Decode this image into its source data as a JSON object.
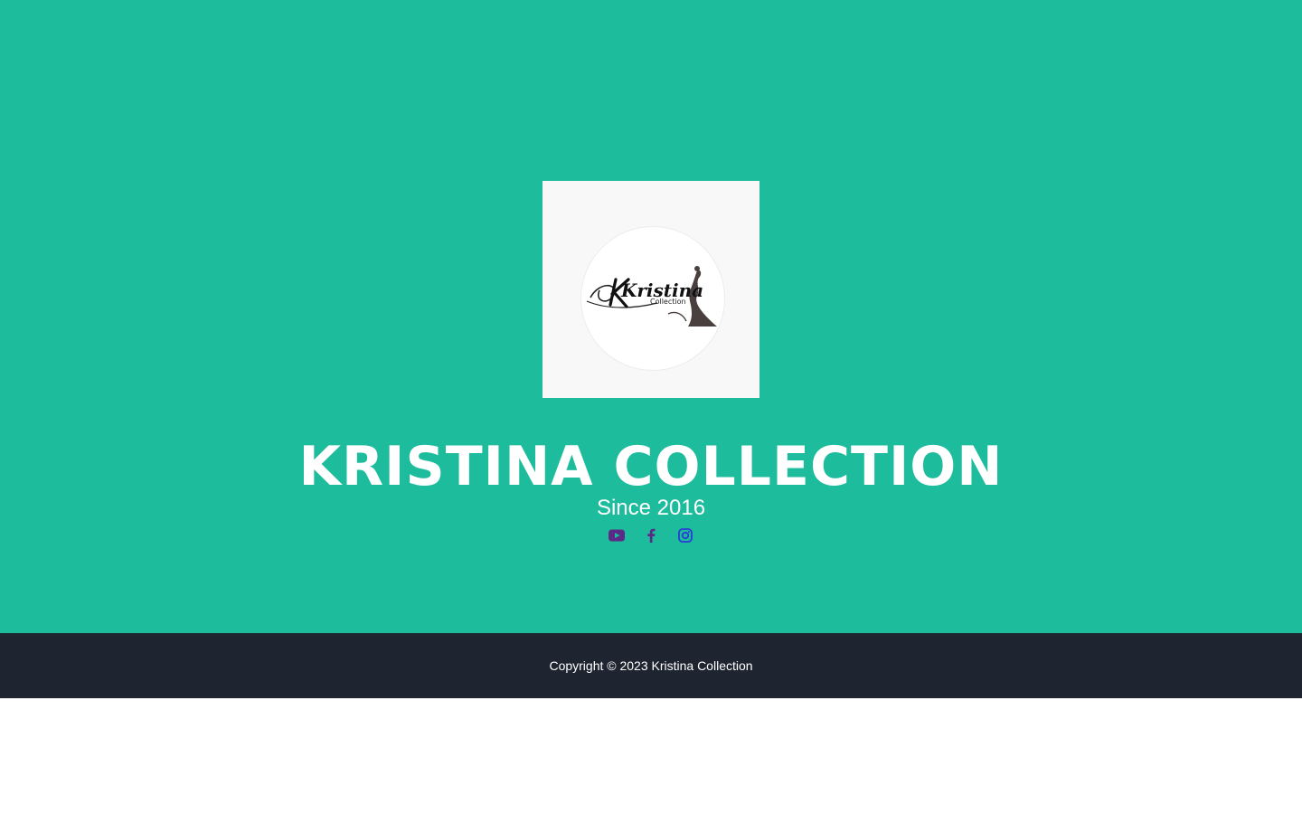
{
  "hero": {
    "background_color": "#1dbc9c",
    "logo": {
      "brand_text": "Kristina",
      "sub_text": "Collection"
    },
    "title": "KRISTINA COLLECTION",
    "tagline": "Since 2016",
    "socials": [
      {
        "name": "youtube",
        "icon": "youtube-icon",
        "color": "#5b2a86"
      },
      {
        "name": "facebook",
        "icon": "facebook-icon",
        "color": "#5b2a86"
      },
      {
        "name": "instagram",
        "icon": "instagram-icon",
        "color": "#2a3bd6"
      }
    ]
  },
  "footer": {
    "background_color": "#1e2530",
    "copyright": "Copyright © 2023 Kristina Collection"
  }
}
